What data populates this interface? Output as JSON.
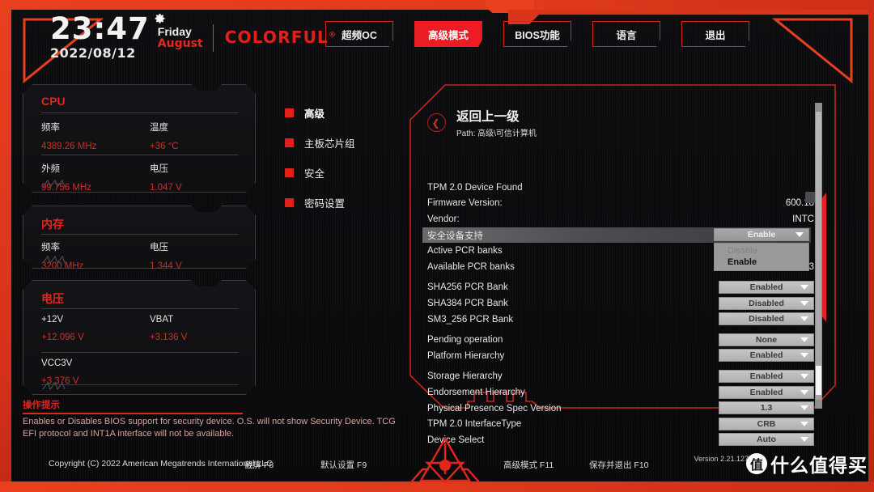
{
  "header": {
    "time": "23:47",
    "date": "2022/08/12",
    "weekday": "Friday",
    "month": "August",
    "brand": "COLORFUL",
    "brand_mark": "®",
    "gear_icon": "gear-icon"
  },
  "topnav": {
    "items": [
      {
        "label": "超频OC",
        "active": false
      },
      {
        "label": "高级模式",
        "active": true
      },
      {
        "label": "BIOS功能",
        "active": false
      },
      {
        "label": "语言",
        "active": false
      },
      {
        "label": "退出",
        "active": false
      }
    ]
  },
  "sidebar": {
    "cards": [
      {
        "title": "CPU",
        "entries": [
          {
            "key": "频率",
            "value": "4389.26 MHz"
          },
          {
            "key": "温度",
            "value": "+36 °C"
          },
          {
            "key": "外频",
            "value": "99.756 MHz"
          },
          {
            "key": "电压",
            "value": "1.047 V"
          }
        ]
      },
      {
        "title": "内存",
        "entries": [
          {
            "key": "频率",
            "value": "3200 MHz"
          },
          {
            "key": "电压",
            "value": "1.344 V"
          }
        ]
      },
      {
        "title": "电压",
        "entries": [
          {
            "key": "+12V",
            "value": "+12.096 V"
          },
          {
            "key": "VBAT",
            "value": "+3.136 V"
          },
          {
            "key": "VCC3V",
            "value": "+3.376 V"
          }
        ]
      }
    ]
  },
  "hint": {
    "title": "操作提示",
    "text": "Enables or Disables BIOS support for security device. O.S. will not show Security Device. TCG EFI protocol and INT1A interface will not be available."
  },
  "midmenu": {
    "items": [
      {
        "label": "高级",
        "active": true
      },
      {
        "label": "主板芯片组",
        "active": false
      },
      {
        "label": "安全",
        "active": false
      },
      {
        "label": "密码设置",
        "active": false
      }
    ]
  },
  "main": {
    "back_label": "返回上一级",
    "back_icon": "chevron-left-icon",
    "path": "Path: 高级\\可信计算机",
    "rows": [
      {
        "label": "TPM 2.0 Device Found",
        "type": "text",
        "value": ""
      },
      {
        "label": "Firmware Version:",
        "type": "text",
        "value": "600.18"
      },
      {
        "label": "Vendor:",
        "type": "text",
        "value": "INTC"
      },
      {
        "label": "安全设备支持",
        "type": "dropdown-open",
        "value": "Enable",
        "highlight": true,
        "options": [
          {
            "label": "Disable",
            "disabled": true
          },
          {
            "label": "Enable",
            "selected": true
          }
        ]
      },
      {
        "label": "Active PCR banks",
        "type": "text",
        "value": ""
      },
      {
        "label": "Available PCR banks",
        "type": "text",
        "value": "SHA256,SHA384,SM3"
      },
      {
        "label": "SHA256 PCR Bank",
        "type": "dropdown",
        "value": "Enabled"
      },
      {
        "label": "SHA384 PCR Bank",
        "type": "dropdown",
        "value": "Disabled"
      },
      {
        "label": "SM3_256 PCR Bank",
        "type": "dropdown",
        "value": "Disabled"
      },
      {
        "label": "Pending operation",
        "type": "dropdown",
        "value": "None"
      },
      {
        "label": "Platform Hierarchy",
        "type": "dropdown",
        "value": "Enabled"
      },
      {
        "label": "Storage Hierarchy",
        "type": "dropdown",
        "value": "Enabled"
      },
      {
        "label": "Endorsement Hierarchy",
        "type": "dropdown",
        "value": "Enabled"
      },
      {
        "label": "Physical Presence Spec Version",
        "type": "dropdown",
        "value": "1.3"
      },
      {
        "label": "TPM 2.0 InterfaceType",
        "type": "dropdown",
        "value": "CRB"
      },
      {
        "label": "Device Select",
        "type": "dropdown",
        "value": "Auto"
      }
    ]
  },
  "footer": {
    "copyright": "Copyright (C) 2022 American Megatrends International LLC",
    "keys": [
      {
        "label": "截屏 F8"
      },
      {
        "label": "默认设置 F9"
      },
      {
        "label": "高级模式 F11"
      },
      {
        "label": "保存并退出 F10"
      }
    ],
    "version": "Version 2.21.1278",
    "watermark_mark": "值",
    "watermark_text": "什么值得买"
  },
  "colors": {
    "accent_red": "#e2261d",
    "frame_orange": "#e8401f",
    "value_red": "#cf2f22",
    "panel_bg": "#0f0f12"
  }
}
